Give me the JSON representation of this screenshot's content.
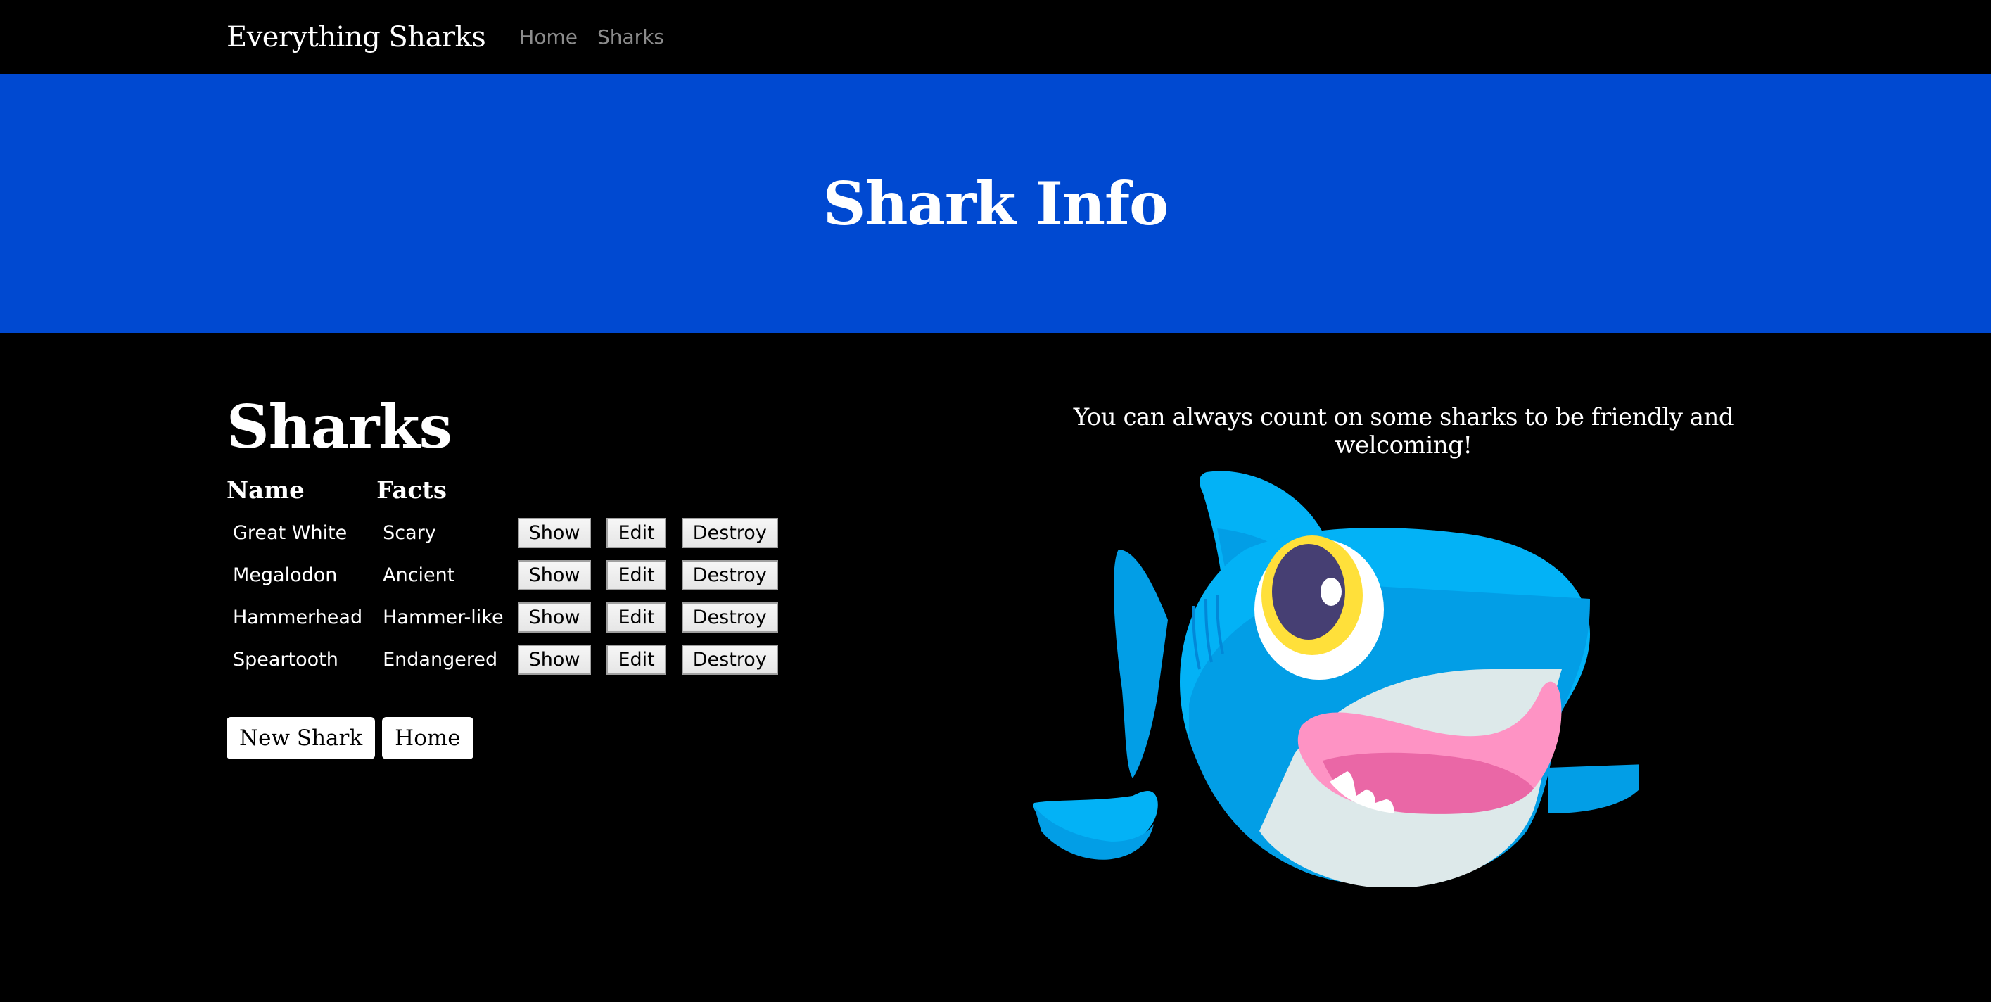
{
  "nav": {
    "brand": "Everything Sharks",
    "links": [
      {
        "label": "Home"
      },
      {
        "label": "Sharks"
      }
    ]
  },
  "hero": {
    "title": "Shark Info"
  },
  "sharks_section": {
    "title": "Sharks",
    "columns": [
      "Name",
      "Facts"
    ],
    "rows": [
      {
        "name": "Great White",
        "facts": "Scary",
        "show": "Show",
        "edit": "Edit",
        "destroy": "Destroy"
      },
      {
        "name": "Megalodon",
        "facts": "Ancient",
        "show": "Show",
        "edit": "Edit",
        "destroy": "Destroy"
      },
      {
        "name": "Hammerhead",
        "facts": "Hammer-like",
        "show": "Show",
        "edit": "Edit",
        "destroy": "Destroy"
      },
      {
        "name": "Speartooth",
        "facts": "Endangered",
        "show": "Show",
        "edit": "Edit",
        "destroy": "Destroy"
      }
    ],
    "actions": {
      "new_shark": "New Shark",
      "home": "Home"
    }
  },
  "aside": {
    "caption": "You can always count on some sharks to be friendly and welcoming!",
    "image": "cartoon-shark-illustration"
  },
  "colors": {
    "hero_bg": "#0049d1",
    "page_bg": "#000000",
    "nav_link": "#8c8c8c"
  }
}
